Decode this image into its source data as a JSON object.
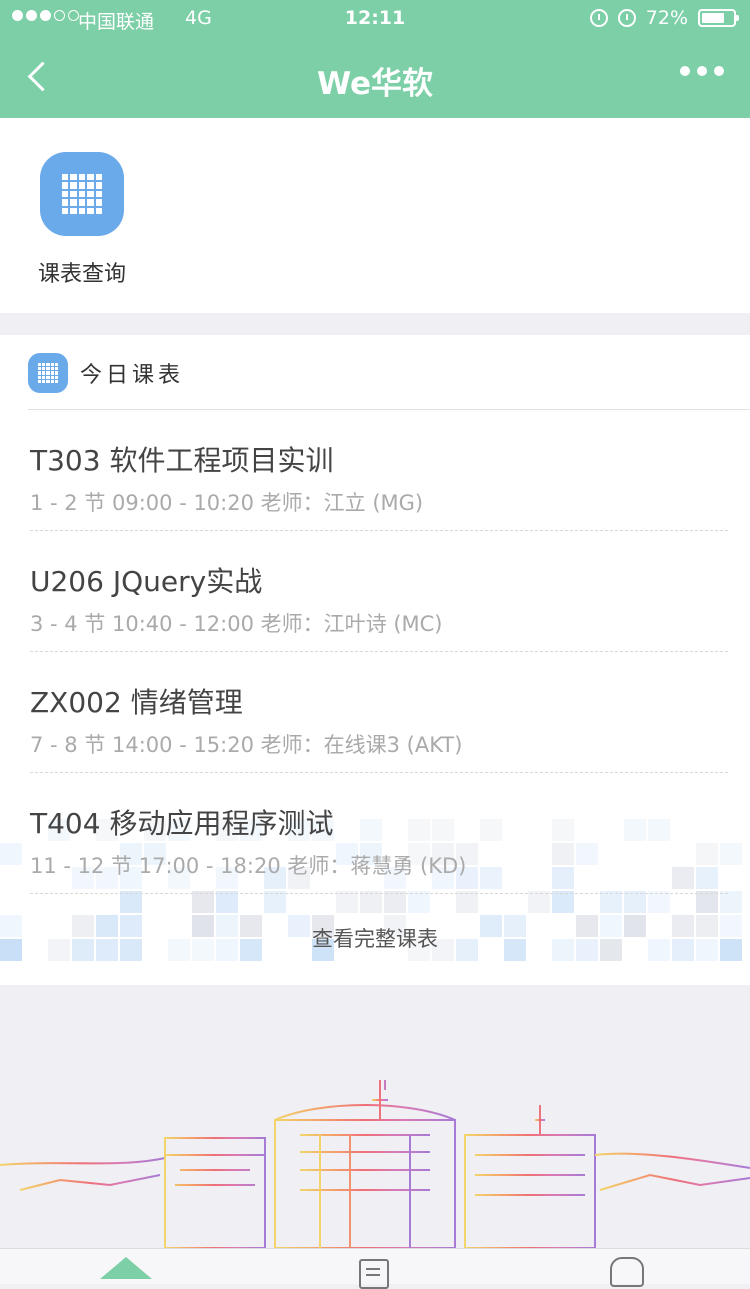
{
  "status_bar": {
    "signal_dots": [
      true,
      true,
      true,
      false,
      false
    ],
    "carrier": "中国联通",
    "network": "4G",
    "time": "12:11",
    "battery_percent": "72%",
    "battery_level": 0.72,
    "icons": [
      "orientation-lock-icon",
      "alarm-icon",
      "battery-icon"
    ]
  },
  "nav": {
    "title": "We华软",
    "back_icon": "chevron-left-icon",
    "more_icon": "more-dots-icon"
  },
  "quick_entry": {
    "items": [
      {
        "label": "课表查询",
        "icon": "calendar-grid-icon"
      }
    ]
  },
  "schedule": {
    "title": "今日课表",
    "courses": [
      {
        "name": "T303 软件工程项目实训",
        "meta": "1 - 2 节 09:00 - 10:20 老师：江立 (MG)"
      },
      {
        "name": "U206 JQuery实战",
        "meta": "3 - 4 节 10:40 - 12:00 老师：江叶诗 (MC)"
      },
      {
        "name": "ZX002 情绪管理",
        "meta": "7 - 8 节 14:00 - 15:20 老师：在线课3 (AKT)"
      },
      {
        "name": "T404 移动应用程序测试",
        "meta": "11 - 12 节 17:00 - 18:20 老师：蒋慧勇 (KD)"
      }
    ],
    "full_link": "查看完整课表"
  },
  "tabbar": {
    "tabs": [
      {
        "icon": "home-icon",
        "active": true
      },
      {
        "icon": "document-icon",
        "active": false
      },
      {
        "icon": "profile-icon",
        "active": false
      }
    ]
  },
  "colors": {
    "theme_green": "#7ccfa6",
    "icon_blue": "#6aa9ea",
    "background": "#efeff4"
  }
}
